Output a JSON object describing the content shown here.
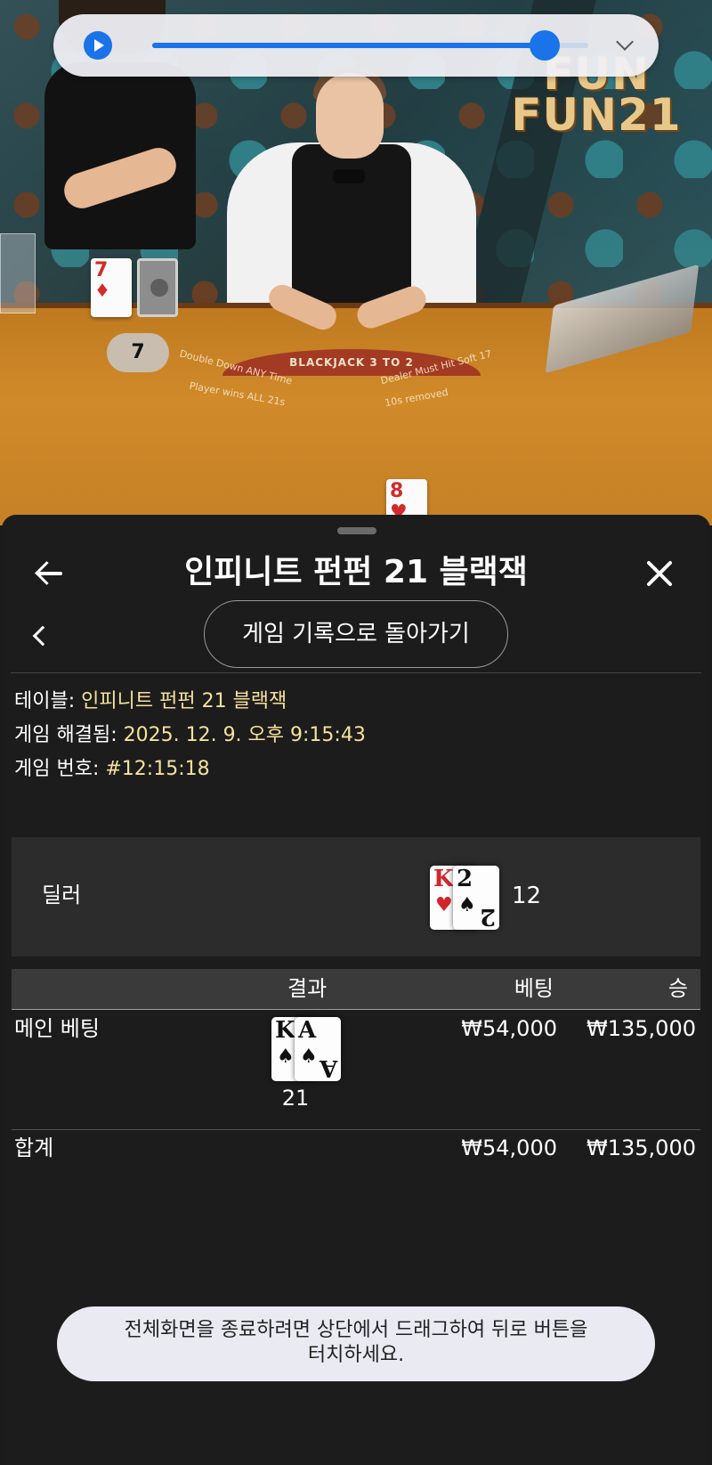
{
  "video": {
    "logo_line1": "FUN",
    "logo_line2": "FUN21",
    "table_arc_text": "BLACKJACK 3 TO 2",
    "table_text_left1": "Double Down ANY Time",
    "table_text_left2": "Player wins ALL 21s",
    "table_text_right1": "Dealer Must Hit Soft 17",
    "table_text_right2": "10s removed",
    "player_card_rank": "7",
    "player_card_suit": "♦",
    "player_score": "7",
    "bottom_card_rank": "8",
    "bottom_card_suit": "♥"
  },
  "media": {
    "progress": 0.9,
    "play_icon": "play-icon",
    "expand_icon": "chevron-down-icon"
  },
  "sheet": {
    "title": "인피니트 펀펀 21 블랙잭",
    "back_icon": "arrow-left-icon",
    "close_icon": "close-icon",
    "prev_icon": "chevron-left-icon",
    "history_button": "게임 기록으로 돌아가기"
  },
  "info": {
    "table_label": "테이블:",
    "table_value": "인피니트 펀펀 21 블랙잭",
    "resolved_label": "게임 해결됨:",
    "resolved_value": "2025. 12. 9. 오후 9:15:43",
    "game_no_label": "게임 번호:",
    "game_no_value": "#12:15:18"
  },
  "dealer": {
    "label": "딜러",
    "total": "12",
    "cards": [
      {
        "rank": "K",
        "suit": "♥",
        "color": "#d3262c"
      },
      {
        "rank": "2",
        "suit": "♠",
        "color": "#111111"
      }
    ]
  },
  "results": {
    "head_result": "결과",
    "head_bet": "베팅",
    "head_win": "승",
    "main_bet_label": "메인 베팅",
    "main_hand_total": "21",
    "main_cards": [
      {
        "rank": "K",
        "suit": "♠",
        "color": "#111111"
      },
      {
        "rank": "A",
        "suit": "♠",
        "color": "#111111"
      }
    ],
    "main_bet": "₩54,000",
    "main_win": "₩135,000",
    "total_label": "합계",
    "total_bet": "₩54,000",
    "total_win": "₩135,000"
  },
  "toast": {
    "line1": "전체화면을 종료하려면 상단에서 드래그하여 뒤로 버튼을",
    "line2": "터치하세요."
  }
}
